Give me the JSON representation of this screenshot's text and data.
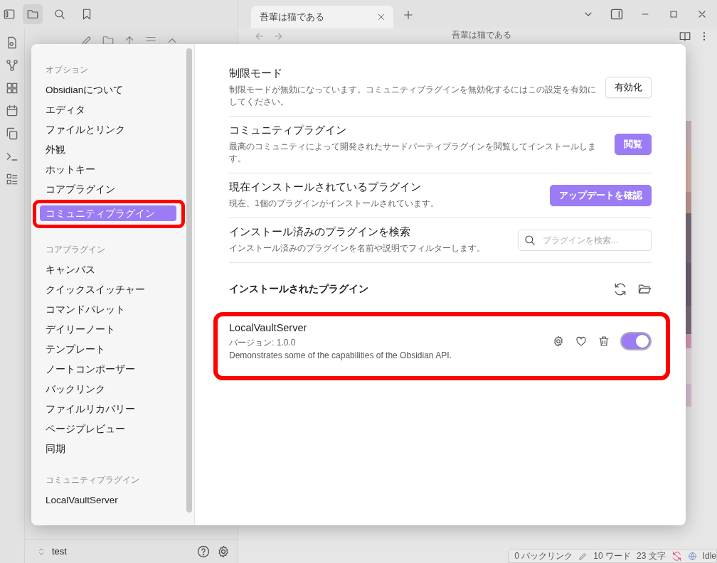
{
  "sidebar_tabs": [
    {
      "kind": "files",
      "selected": true
    },
    {
      "kind": "search",
      "selected": false
    },
    {
      "kind": "bookmarks",
      "selected": false
    }
  ],
  "tabs": [
    {
      "label": "吾輩は猫である",
      "selected": true
    }
  ],
  "editor": {
    "title": "吾輩は猫である"
  },
  "file_pane": {
    "vault_name": "test"
  },
  "status_bar": {
    "backlinks": "0 バックリンク",
    "words": "10 ワード",
    "characters": "23 文字",
    "sync": "Idle"
  },
  "settings": {
    "sidebar": {
      "sections": [
        {
          "heading": "オプション",
          "items": [
            {
              "label": "Obsidianについて",
              "selected": false,
              "highlighted": false
            },
            {
              "label": "エディタ",
              "selected": false,
              "highlighted": false
            },
            {
              "label": "ファイルとリンク",
              "selected": false,
              "highlighted": false
            },
            {
              "label": "外観",
              "selected": false,
              "highlighted": false
            },
            {
              "label": "ホットキー",
              "selected": false,
              "highlighted": false
            },
            {
              "label": "コアプラグイン",
              "selected": false,
              "highlighted": false
            },
            {
              "label": "コミュニティプラグイン",
              "selected": true,
              "highlighted": true
            }
          ]
        },
        {
          "heading": "コアプラグイン",
          "items": [
            {
              "label": "キャンバス",
              "selected": false,
              "highlighted": false
            },
            {
              "label": "クイックスイッチャー",
              "selected": false,
              "highlighted": false
            },
            {
              "label": "コマンドパレット",
              "selected": false,
              "highlighted": false
            },
            {
              "label": "デイリーノート",
              "selected": false,
              "highlighted": false
            },
            {
              "label": "テンプレート",
              "selected": false,
              "highlighted": false
            },
            {
              "label": "ノートコンポーザー",
              "selected": false,
              "highlighted": false
            },
            {
              "label": "バックリンク",
              "selected": false,
              "highlighted": false
            },
            {
              "label": "ファイルリカバリー",
              "selected": false,
              "highlighted": false
            },
            {
              "label": "ページプレビュー",
              "selected": false,
              "highlighted": false
            },
            {
              "label": "同期",
              "selected": false,
              "highlighted": false
            }
          ]
        },
        {
          "heading": "コミュニティプラグイン",
          "items": [
            {
              "label": "LocalVaultServer",
              "selected": false,
              "highlighted": false
            }
          ]
        }
      ]
    },
    "rows": [
      {
        "name": "制限モード",
        "description": "制限モードが無効になっています。コミュニティプラグインを無効化するにはこの設定を有効にしてください。",
        "control": {
          "kind": "button",
          "label": "有効化",
          "primary": false
        }
      },
      {
        "name": "コミュニティプラグイン",
        "description": "最高のコミュニティによって開発されたサードパーティプラグインを閲覧してインストールします。",
        "control": {
          "kind": "button",
          "label": "閲覧",
          "primary": true
        }
      },
      {
        "name": "現在インストールされているプラグイン",
        "description": "現在、1個のプラグインがインストールされています。",
        "control": {
          "kind": "button",
          "label": "アップデートを確認",
          "primary": true
        }
      },
      {
        "name": "インストール済みのプラグインを検索",
        "description": "インストール済みのプラグインを名前や説明でフィルターします。",
        "control": {
          "kind": "search",
          "placeholder": "プラグインを検索..."
        }
      }
    ],
    "installed": {
      "heading": "インストールされたプラグイン",
      "plugins": [
        {
          "name": "LocalVaultServer",
          "version": "バージョン: 1.0.0",
          "description": "Demonstrates some of the capabilities of the Obsidian API.",
          "enabled": true,
          "highlighted": true
        }
      ]
    }
  }
}
